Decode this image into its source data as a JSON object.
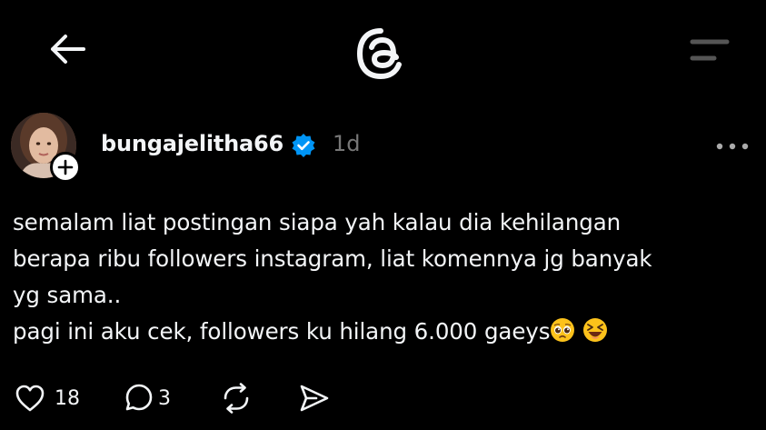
{
  "nav": {
    "back_icon": "arrow-left-icon",
    "logo_icon": "threads-logo-icon",
    "menu_icon": "menu-icon"
  },
  "post": {
    "username": "bungajelitha66",
    "verified": true,
    "timestamp": "1d",
    "text_lines": [
      "semalam liat postingan siapa yah kalau dia kehilangan",
      "berapa ribu followers instagram, liat komennya jg banyak",
      "yg sama..",
      "pagi ini aku cek, followers ku hilang 6.000 gaeys"
    ],
    "emojis": [
      "pleading-face-emoji",
      "squinting-laughing-face-emoji"
    ]
  },
  "actions": {
    "likes": "18",
    "replies": "3",
    "repost_icon": "repost-icon",
    "share_icon": "send-icon"
  },
  "colors": {
    "background": "#000000",
    "text": "#f3f5f7",
    "muted": "#777777",
    "verified": "#0095f6"
  }
}
